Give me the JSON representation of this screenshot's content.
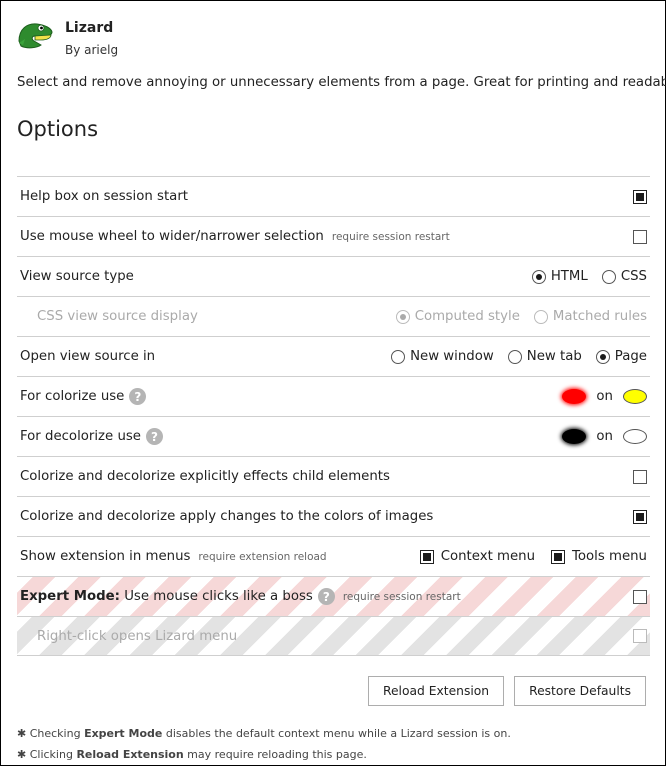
{
  "header": {
    "title": "Lizard",
    "author": "By arielg"
  },
  "description": "Select and remove annoying or unnecessary elements from a page. Great for printing and readability.",
  "options_title": "Options",
  "rows": {
    "help_box": {
      "label": "Help box on session start",
      "checked": true
    },
    "mouse_wheel": {
      "label": "Use mouse wheel to wider/narrower selection",
      "note": "require session restart",
      "checked": false
    },
    "view_source_type": {
      "label": "View source type",
      "options": [
        "HTML",
        "CSS"
      ],
      "selected": "HTML"
    },
    "css_view_display": {
      "label": "CSS view source display",
      "options": [
        "Computed style",
        "Matched rules"
      ],
      "selected": "Computed style",
      "disabled": true
    },
    "open_view_source": {
      "label": "Open view source in",
      "options": [
        "New window",
        "New tab",
        "Page"
      ],
      "selected": "Page"
    },
    "colorize": {
      "label": "For colorize use",
      "help": "?",
      "on_word": "on",
      "fg_color": "#ff0000",
      "bg_color": "#ffff00"
    },
    "decolorize": {
      "label": "For decolorize use",
      "help": "?",
      "on_word": "on",
      "fg_color": "#000000",
      "bg_color": "#ffffff"
    },
    "child_elements": {
      "label": "Colorize and decolorize explicitly effects child elements",
      "checked": false
    },
    "images": {
      "label": "Colorize and decolorize apply changes to the colors of images",
      "checked": true
    },
    "menus": {
      "label": "Show extension in menus",
      "note": "require extension reload",
      "context_menu": "Context menu",
      "tools_menu": "Tools menu",
      "context_checked": true,
      "tools_checked": true
    },
    "expert_mode": {
      "label_bold": "Expert Mode:",
      "label": "Use mouse clicks like a boss",
      "help": "?",
      "note": "require session restart",
      "checked": false
    },
    "right_click": {
      "label": "Right-click opens Lizard menu",
      "checked": false,
      "disabled": true
    }
  },
  "buttons": {
    "reload": "Reload Extension",
    "restore": "Restore Defaults"
  },
  "footnotes": {
    "n1_prefix": "✱ Checking ",
    "n1_bold": "Expert Mode",
    "n1_suffix": " disables the default context menu while a Lizard session is on.",
    "n2_prefix": "✱ Clicking ",
    "n2_bold": "Reload Extension",
    "n2_suffix": " may require reloading this page."
  },
  "colors": {
    "expert_stripe": "#f6d8d8",
    "disabled_stripe": "#e3e3e3"
  }
}
